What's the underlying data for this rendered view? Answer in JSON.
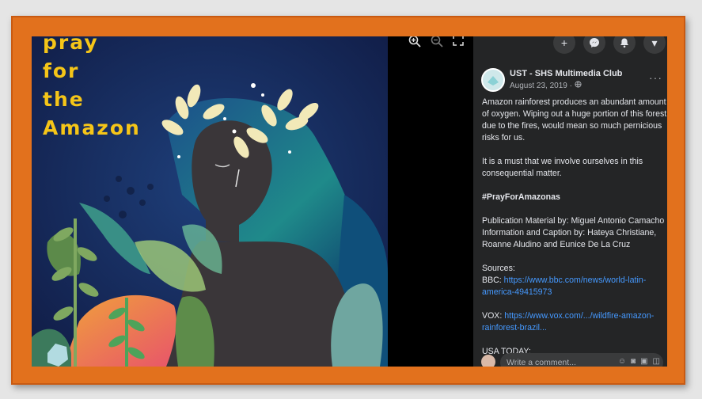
{
  "poster": {
    "line1": "pray",
    "line2": "for",
    "line3": "the",
    "line4": "Amazon"
  },
  "viewer_tools": {
    "zoom_in_icon": "zoom-in-icon",
    "zoom_out_icon": "zoom-out-icon",
    "fullscreen_icon": "fullscreen-icon"
  },
  "top_bar": {
    "icons": [
      "plus-icon",
      "messenger-icon",
      "bell-icon",
      "caret-icon"
    ],
    "glyphs": [
      "+",
      "✉",
      "🔔",
      "▾"
    ]
  },
  "post": {
    "page_name": "UST - SHS Multimedia Club",
    "date": "August 23, 2019 ·",
    "more_label": "···",
    "para1": "Amazon rainforest produces an abundant amount of oxygen. Wiping out a huge portion of this forest due to the fires, would mean so much pernicious risks for us.",
    "para2": "It is a must that we involve ourselves in this consequential matter.",
    "hashtag": "#PrayForAmazonas",
    "credit1": "Publication Material by: Miguel Antonio Camacho",
    "credit2": "Information and Caption by: Hateya Christiane, Roanne Aludino and Eunice De La Cruz",
    "sources_label": "Sources:",
    "bbc_label": "BBC: ",
    "bbc_link": "https://www.bbc.com/news/world-latin-america-49415973",
    "vox_label": "VOX: ",
    "vox_link": "https://www.vox.com/.../wildfire-amazon-rainforest-brazil...",
    "usa_today": "USA TODAY:"
  },
  "comment": {
    "placeholder": "Write a comment..."
  },
  "colors": {
    "frame": "#e2711d",
    "panel_bg": "#242526",
    "link": "#4599ff",
    "poster_text": "#f5c518"
  }
}
